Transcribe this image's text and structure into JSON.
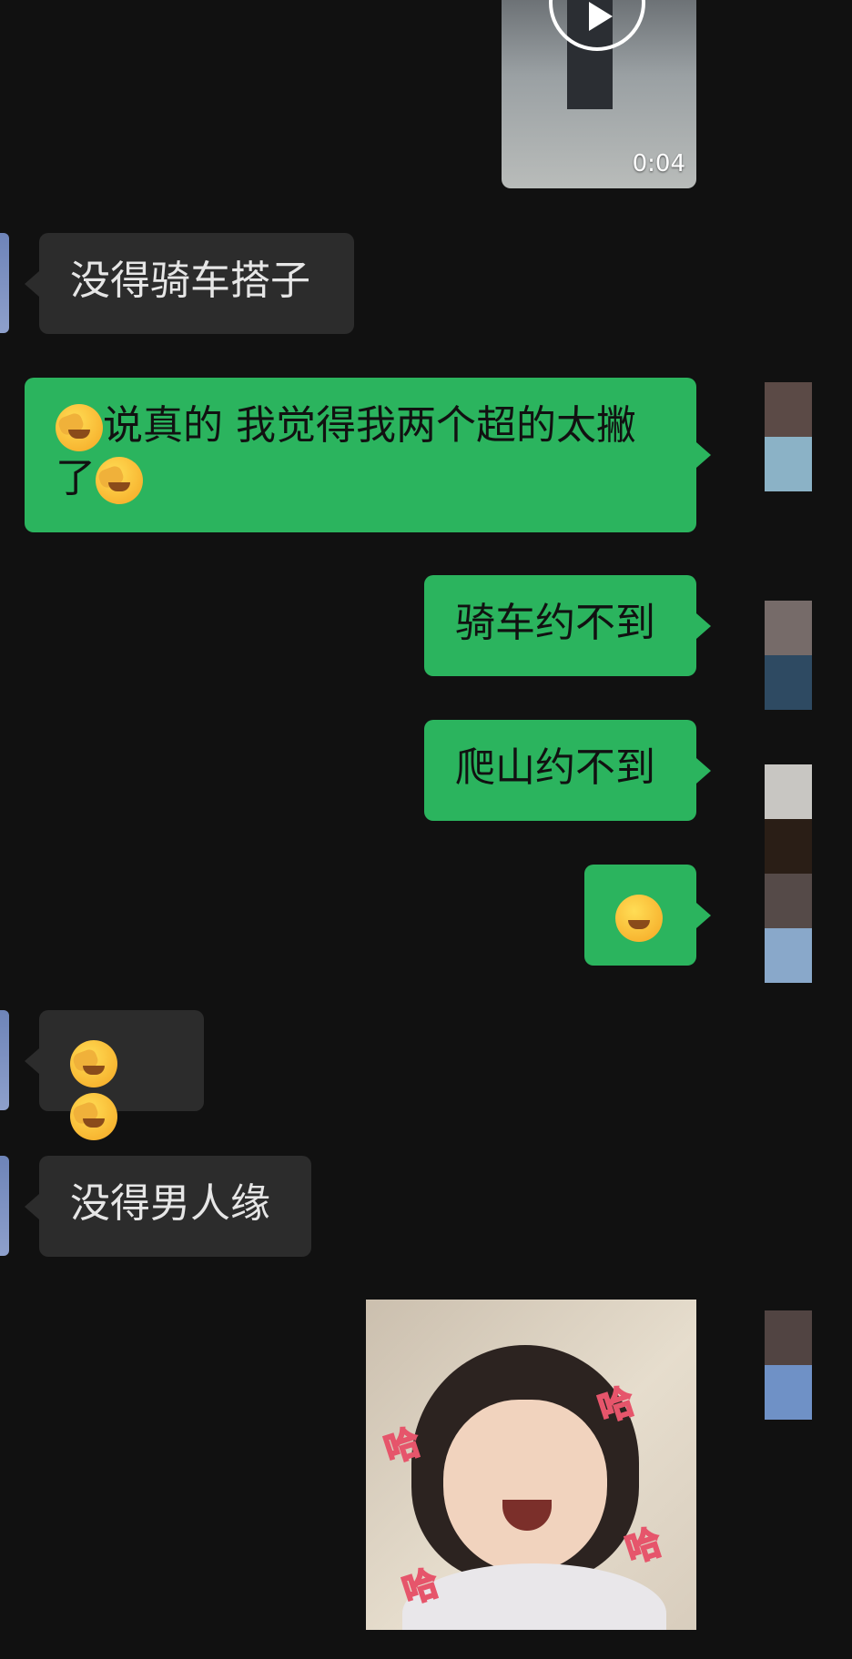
{
  "video": {
    "duration": "0:04"
  },
  "messages": [
    {
      "side": "in",
      "text": "没得骑车搭子"
    },
    {
      "side": "out",
      "text_line1": "说真的 我觉得我两个超的太撇",
      "text_line2": "了"
    },
    {
      "side": "out",
      "text": "骑车约不到"
    },
    {
      "side": "out",
      "text": "爬山约不到"
    },
    {
      "side": "out",
      "emoji": "hand-over-mouth-emoji"
    },
    {
      "side": "in",
      "emoji": "face-palm-crying-emoji x2"
    },
    {
      "side": "in",
      "text": "没得男人缘"
    }
  ],
  "sticker": {
    "ha_texts": [
      "哈",
      "哈",
      "哈",
      "哈"
    ]
  },
  "colors": {
    "background": "#111111",
    "incoming": "#2c2c2c",
    "outgoing": "#2bb45e"
  }
}
